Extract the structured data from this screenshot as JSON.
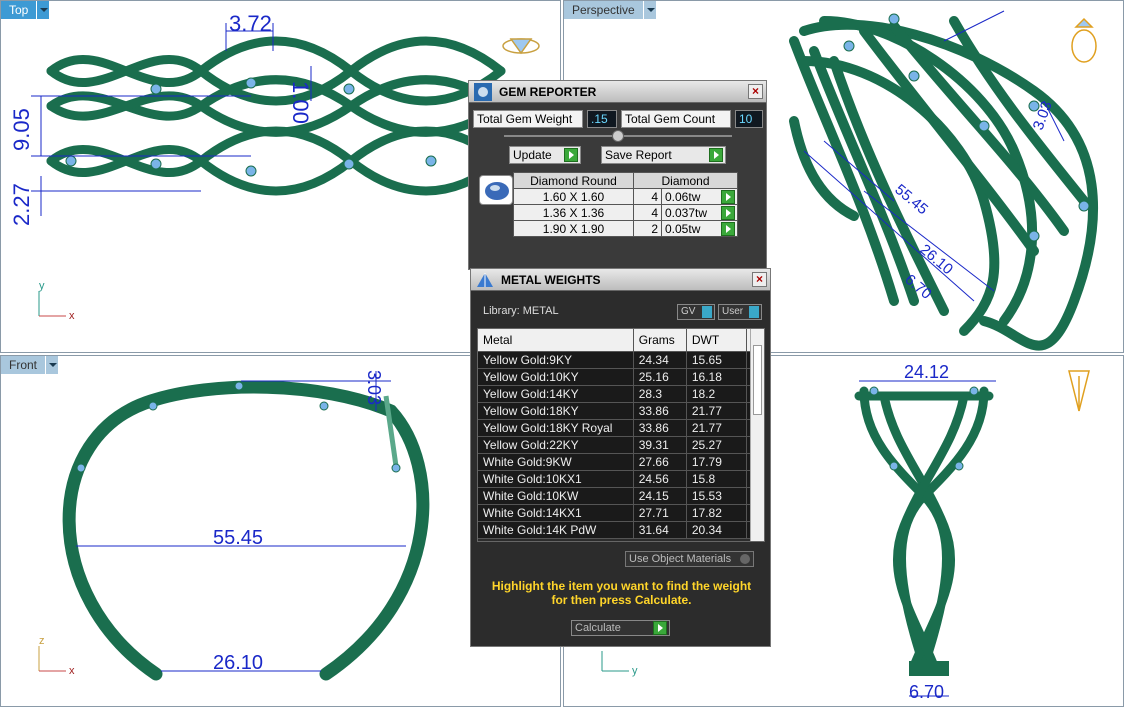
{
  "viewports": {
    "top": {
      "label": "Top"
    },
    "perspective": {
      "label": "Perspective"
    },
    "front": {
      "label": "Front"
    }
  },
  "dimensions": {
    "top": [
      "3.72",
      "1.00",
      "9.05",
      "2.27"
    ],
    "perspective": [
      "55.45",
      "26.10",
      "3.03",
      "6.70"
    ],
    "front": [
      "3.03",
      "55.45",
      "26.10"
    ],
    "right": [
      "24.12",
      "6.70"
    ]
  },
  "axes": {
    "top": [
      "y",
      "x"
    ],
    "front": [
      "z",
      "x"
    ],
    "right": [
      "y"
    ]
  },
  "gem_reporter": {
    "title": "GEM REPORTER",
    "total_weight_label": "Total Gem Weight",
    "total_weight_value": ".15",
    "total_count_label": "Total Gem Count",
    "total_count_value": "10",
    "update_label": "Update",
    "save_report_label": "Save Report",
    "table_headers": [
      "Diamond Round",
      "Diamond"
    ],
    "rows": [
      {
        "size": "1.60 X 1.60",
        "count": "4",
        "weight": "0.06tw"
      },
      {
        "size": "1.36 X 1.36",
        "count": "4",
        "weight": "0.037tw"
      },
      {
        "size": "1.90 X 1.90",
        "count": "2",
        "weight": "0.05tw"
      }
    ]
  },
  "metal_weights": {
    "title": "METAL WEIGHTS",
    "library_label": "Library:",
    "library_value": "METAL",
    "gv_label": "GV",
    "user_label": "User",
    "columns": [
      "Metal",
      "Grams",
      "DWT"
    ],
    "rows": [
      {
        "metal": "Yellow Gold:9KY",
        "grams": "24.34",
        "dwt": "15.65"
      },
      {
        "metal": "Yellow Gold:10KY",
        "grams": "25.16",
        "dwt": "16.18"
      },
      {
        "metal": "Yellow Gold:14KY",
        "grams": "28.3",
        "dwt": "18.2"
      },
      {
        "metal": "Yellow Gold:18KY",
        "grams": "33.86",
        "dwt": "21.77"
      },
      {
        "metal": "Yellow Gold:18KY Royal",
        "grams": "33.86",
        "dwt": "21.77"
      },
      {
        "metal": "Yellow Gold:22KY",
        "grams": "39.31",
        "dwt": "25.27"
      },
      {
        "metal": "White Gold:9KW",
        "grams": "27.66",
        "dwt": "17.79"
      },
      {
        "metal": "White Gold:10KX1",
        "grams": "24.56",
        "dwt": "15.8"
      },
      {
        "metal": "White Gold:10KW",
        "grams": "24.15",
        "dwt": "15.53"
      },
      {
        "metal": "White Gold:14KX1",
        "grams": "27.71",
        "dwt": "17.82"
      },
      {
        "metal": "White Gold:14K PdW",
        "grams": "31.64",
        "dwt": "20.34"
      }
    ],
    "use_object_materials_label": "Use Object Materials",
    "hint": "Highlight the item you want to find the weight for then press Calculate.",
    "calculate_label": "Calculate"
  },
  "colors": {
    "metal": "#1a6e4e",
    "dim": "#1a28c8",
    "gem": "#7ab4e8",
    "tab": "#3d9ad4"
  }
}
